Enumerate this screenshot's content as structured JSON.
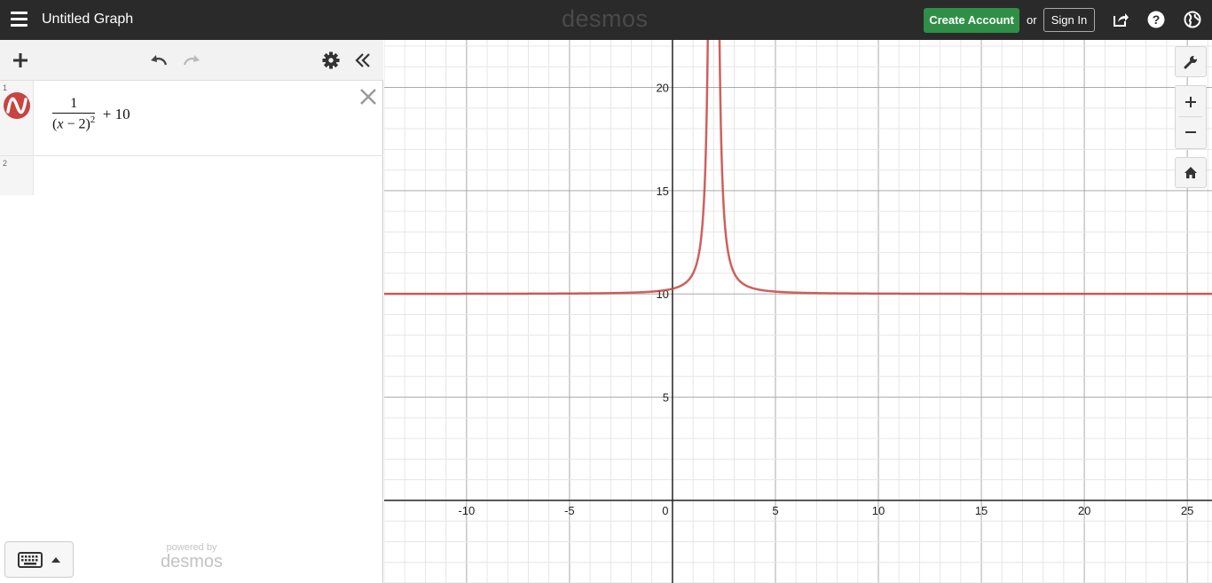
{
  "header": {
    "graph_title": "Untitled Graph",
    "brand": "desmos",
    "create_account_label": "Create Account",
    "or_text": "or",
    "sign_in_label": "Sign In"
  },
  "expressions": {
    "items": [
      {
        "index": "1",
        "numerator": "1",
        "var": "x",
        "denominator_rest": " − 2)",
        "exponent": "2",
        "tail": "+ 10",
        "color": "#c74440"
      },
      {
        "index": "2"
      }
    ]
  },
  "footer": {
    "powered_small": "powered by",
    "powered_brand": "desmos"
  },
  "chart_data": {
    "type": "line",
    "function": "1/(x-2)^2 + 10",
    "series": [
      {
        "color": "#c74440"
      }
    ],
    "xlim": [
      -14,
      26.2
    ],
    "ylim": [
      -4,
      22.3
    ],
    "x_ticks": [
      -10,
      -5,
      0,
      5,
      10,
      15,
      20,
      25
    ],
    "y_ticks": [
      5,
      10,
      15,
      20
    ],
    "x_tick_labels": [
      "-10",
      "-5",
      "0",
      "5",
      "10",
      "15",
      "20",
      "25"
    ],
    "y_tick_labels": [
      "5",
      "10",
      "15",
      "20"
    ],
    "grid": true
  }
}
